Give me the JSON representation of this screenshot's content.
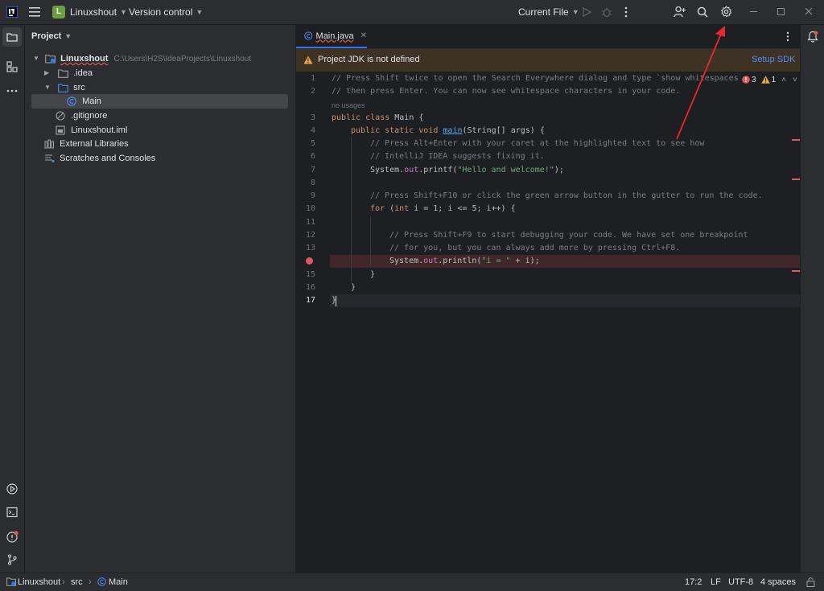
{
  "titlebar": {
    "project_initial": "L",
    "project_name": "Linuxshout",
    "vcs_label": "Version control",
    "run_config": "Current File"
  },
  "project_panel": {
    "title": "Project",
    "tree": {
      "root_name": "Linuxshout",
      "root_path": "C:\\Users\\H2S\\IdeaProjects\\Linuxshout",
      "idea": ".idea",
      "src": "src",
      "main": "Main",
      "gitignore": ".gitignore",
      "iml": "Linuxshout.iml",
      "ext_libs": "External Libraries",
      "scratches": "Scratches and Consoles"
    }
  },
  "editor": {
    "tab_label": "Main.java",
    "banner_text": "Project JDK is not defined",
    "banner_action": "Setup SDK",
    "error_count": "3",
    "warning_count": "1",
    "usage_hint": "no usages",
    "line_numbers": [
      "1",
      "2",
      "3",
      "4",
      "5",
      "6",
      "7",
      "8",
      "9",
      "10",
      "11",
      "12",
      "13",
      "14",
      "15",
      "16",
      "17"
    ],
    "lines": {
      "l1": "// Press Shift twice to open the Search Everywhere dialog and type `show whitespaces`",
      "l2": "// then press Enter. You can now see whitespace characters in your code.",
      "l3_kw": "public class",
      "l3_rest": " Main {",
      "l4_kw": "public static void",
      "l4_fn": "main",
      "l4_rest": "(String[] args) {",
      "l5": "// Press Alt+Enter with your caret at the highlighted text to see how",
      "l6": "// IntelliJ IDEA suggests fixing it.",
      "l7_a": "System.",
      "l7_fld": "out",
      "l7_b": ".printf(",
      "l7_str": "\"Hello and welcome!\"",
      "l7_c": ");",
      "l9": "// Press Shift+F10 or click the green arrow button in the gutter to run the code.",
      "l10_kw": "for",
      "l10_a": " (",
      "l10_kw2": "int",
      "l10_b": " i = 1; i <= 5; i++) {",
      "l12": "// Press Shift+F9 to start debugging your code. We have set one breakpoint",
      "l13": "// for you, but you can always add more by pressing Ctrl+F8.",
      "l14_a": "System.",
      "l14_fld": "out",
      "l14_b": ".println(",
      "l14_str": "\"i = \"",
      "l14_c": " + i);",
      "l15": "}",
      "l16": "}",
      "l17": "}"
    }
  },
  "statusbar": {
    "crumb_project": "Linuxshout",
    "crumb_src": "src",
    "crumb_main": "Main",
    "position": "17:2",
    "line_sep": "LF",
    "encoding": "UTF-8",
    "indent": "4 spaces"
  },
  "colors": {
    "accent": "#3574f0",
    "error": "#db5c5c",
    "warning": "#e5a74b",
    "annotation_arrow": "#e8282b"
  }
}
